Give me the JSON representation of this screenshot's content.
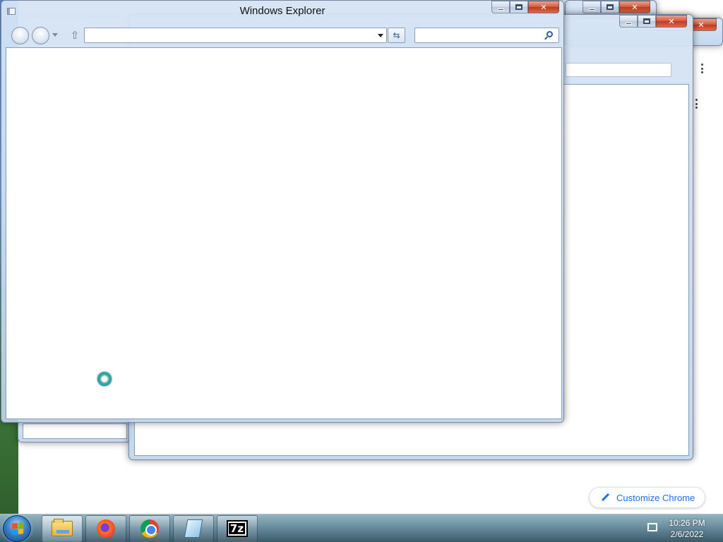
{
  "explorer_window": {
    "title": "Windows Explorer",
    "address_value": "",
    "search_placeholder": ""
  },
  "chrome": {
    "customize_label": "Customize Chrome"
  },
  "taskbar": {
    "apps": [
      {
        "name": "windows-explorer",
        "icon": "folder-icon"
      },
      {
        "name": "firefox",
        "icon": "firefox-icon"
      },
      {
        "name": "chrome",
        "icon": "chrome-icon"
      },
      {
        "name": "notepad",
        "icon": "notepad-icon"
      },
      {
        "name": "7-zip",
        "icon": "7zip-icon",
        "label": "7z"
      }
    ],
    "clock_time": "10:26 PM",
    "clock_date": "2/6/2022"
  },
  "colors": {
    "accent": "#1a73e8",
    "close_button": "#c23a1c"
  }
}
